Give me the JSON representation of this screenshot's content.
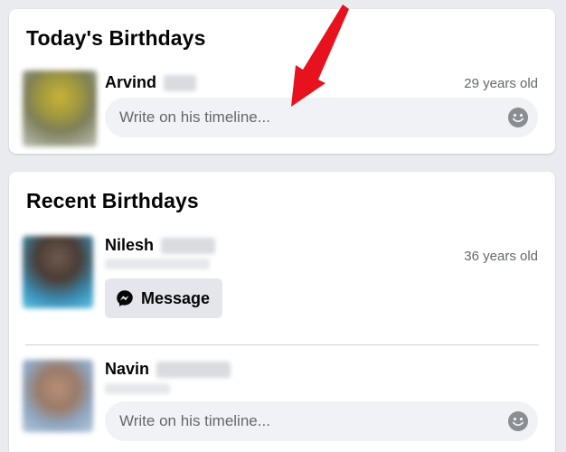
{
  "today": {
    "title": "Today's Birthdays",
    "person": {
      "first_name": "Arvind",
      "age": "29 years old",
      "write_placeholder": "Write on his timeline..."
    }
  },
  "recent": {
    "title": "Recent Birthdays",
    "people": [
      {
        "first_name": "Nilesh",
        "age": "36 years old",
        "message_label": "Message"
      },
      {
        "first_name": "Navin",
        "write_placeholder": "Write on his timeline..."
      }
    ]
  },
  "colors": {
    "page_bg": "#e9ebee",
    "card_bg": "#ffffff",
    "input_bg": "#f0f2f5",
    "button_bg": "#e4e6eb",
    "secondary_text": "#65676b",
    "annotation_arrow": "#e8121e"
  },
  "icons": {
    "emoji": "smiley-icon",
    "messenger": "messenger-icon",
    "annotation": "red-arrow-annotation"
  }
}
